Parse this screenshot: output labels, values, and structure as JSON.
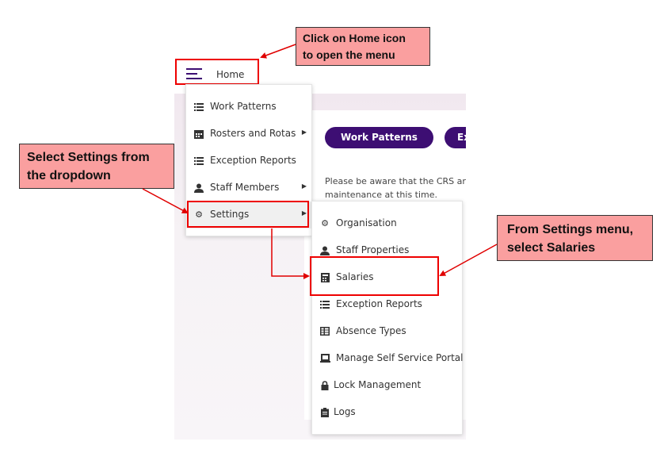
{
  "header": {
    "home_label": "Home",
    "menu_icon": "hamburger-icon"
  },
  "buttons": {
    "work_patterns": "Work Patterns",
    "partial_button": "Ex"
  },
  "notice": {
    "line1": "Please be aware that the CRS ar",
    "line2": "maintenance at this time."
  },
  "main_menu": {
    "items": [
      {
        "label": "Work Patterns",
        "icon": "list-icon",
        "has_submenu": false
      },
      {
        "label": "Rosters and Rotas",
        "icon": "calendar-icon",
        "has_submenu": true
      },
      {
        "label": "Exception Reports",
        "icon": "list-icon",
        "has_submenu": false
      },
      {
        "label": "Staff Members",
        "icon": "user-icon",
        "has_submenu": true
      },
      {
        "label": "Settings",
        "icon": "gear-icon",
        "has_submenu": true
      }
    ]
  },
  "settings_menu": {
    "items": [
      {
        "label": "Organisation",
        "icon": "gear-icon"
      },
      {
        "label": "Staff Properties",
        "icon": "user-icon"
      },
      {
        "label": "Salaries",
        "icon": "calculator-icon"
      },
      {
        "label": "Exception Reports",
        "icon": "list-icon"
      },
      {
        "label": "Absence Types",
        "icon": "table-icon"
      },
      {
        "label": "Manage Self Service Portal",
        "icon": "laptop-icon"
      },
      {
        "label": "Lock Management",
        "icon": "lock-icon"
      },
      {
        "label": "Logs",
        "icon": "clipboard-icon"
      }
    ]
  },
  "callouts": {
    "home": {
      "line1": "Click on Home icon",
      "line2": "to open the menu"
    },
    "settings": {
      "line1": "Select Settings from",
      "line2": "the dropdown"
    },
    "salaries": {
      "line1": "From Settings menu,",
      "line2": "select Salaries"
    }
  },
  "colors": {
    "brand_purple": "#3d0e73",
    "callout_fill": "#fa9f9f",
    "highlight_red": "#e00000"
  }
}
